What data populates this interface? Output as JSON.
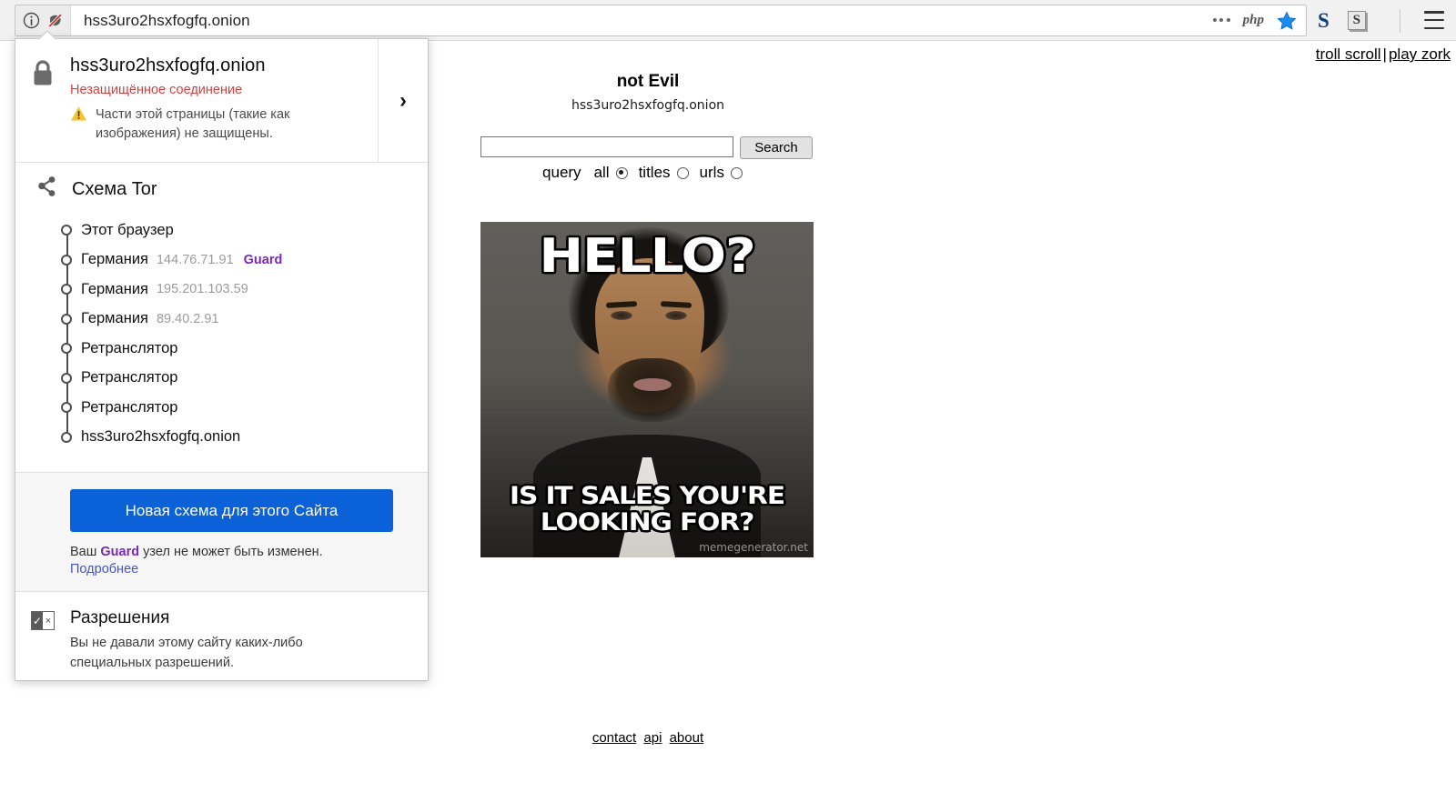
{
  "browser": {
    "urlbar": {
      "url": "hss3uro2hsxfogfq.onion",
      "info_icon": "info-circle-icon",
      "mixed_content_icon": "broken-shield-icon",
      "dots_icon": "page-actions-dots-icon",
      "php_icon_label": "php",
      "bookmark_icon": "star-icon"
    },
    "extensions": [
      {
        "name": "ext-s-letter",
        "label": "S"
      },
      {
        "name": "ext-s-box",
        "label": "S"
      }
    ],
    "menu_icon": "hamburger-menu-icon"
  },
  "identity_panel": {
    "host": "hss3uro2hsxfogfq.onion",
    "status": "Незащищённое соединение",
    "warning": "Части этой страницы (такие как изображения) не защищены.",
    "more_chevron": "›",
    "lock_icon": "padlock-icon",
    "warning_icon": "warning-triangle-icon",
    "tor": {
      "title": "Схема Tor",
      "icon": "tor-circuit-icon",
      "nodes": [
        {
          "label": "Этот браузер",
          "ip": "",
          "tag": ""
        },
        {
          "label": "Германия",
          "ip": "144.76.71.91",
          "tag": "Guard"
        },
        {
          "label": "Германия",
          "ip": "195.201.103.59",
          "tag": ""
        },
        {
          "label": "Германия",
          "ip": "89.40.2.91",
          "tag": ""
        },
        {
          "label": "Ретранслятор",
          "ip": "",
          "tag": ""
        },
        {
          "label": "Ретранслятор",
          "ip": "",
          "tag": ""
        },
        {
          "label": "Ретранслятор",
          "ip": "",
          "tag": ""
        },
        {
          "label": "hss3uro2hsxfogfq.onion",
          "ip": "",
          "tag": ""
        }
      ],
      "new_circuit_button": "Новая схема для этого Сайта",
      "guard_note_before": "Ваш ",
      "guard_note_bold": "Guard",
      "guard_note_after": " узел не может быть изменен.",
      "learn_more": "Подробнее"
    },
    "permissions": {
      "icon": "permissions-icon",
      "title": "Разрешения",
      "description": "Вы не давали этому сайту каких-либо специальных разрешений."
    }
  },
  "page": {
    "top_links": [
      {
        "label": "troll scroll"
      },
      {
        "label": "play zork"
      }
    ],
    "top_links_separator": "|",
    "site_title": "not Evil",
    "site_host": "hss3uro2hsxfogfq.onion",
    "search": {
      "value": "",
      "placeholder": "",
      "button_label": "Search"
    },
    "radio_group": {
      "label": "query",
      "options": [
        {
          "name": "all",
          "checked": true
        },
        {
          "name": "titles",
          "checked": false
        },
        {
          "name": "urls",
          "checked": false
        }
      ]
    },
    "meme": {
      "top_text": "HELLO?",
      "bottom_text": "IS IT SALES YOU'RE LOOKING FOR?",
      "watermark": "memegenerator.net",
      "alt": "Lionel Richie Hello meme"
    },
    "footer_links": [
      {
        "label": "contact"
      },
      {
        "label": "api"
      },
      {
        "label": "about"
      }
    ]
  },
  "colors": {
    "accent_blue": "#0a61d8",
    "insecure_red": "#d73f3f",
    "guard_purple": "#7a28b8",
    "link_blue": "#4455cc"
  }
}
